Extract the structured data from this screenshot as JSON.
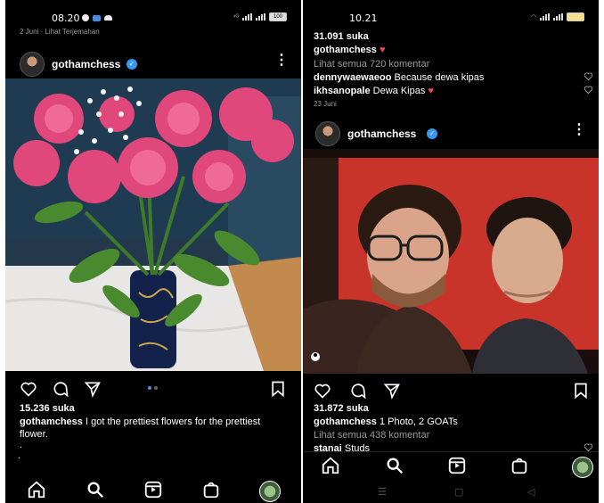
{
  "left": {
    "status": {
      "time": "08.20",
      "battery": "100"
    },
    "subline": "2 Juni · Lihat Terjemahan",
    "post": {
      "username": "gothamchess",
      "likes": "15.236 suka",
      "caption_user": "gothamchess",
      "caption_text": "I got the prettiest flowers for the prettiest flower.",
      "caption_extra": [
        ".",
        " ."
      ]
    },
    "nav": [
      "home-icon",
      "search-icon",
      "reels-icon",
      "shop-icon",
      "profile-avatar"
    ]
  },
  "right": {
    "status": {
      "time": "10.21"
    },
    "prev_post": {
      "likes": "31.091 suka",
      "caption_user": "gothamchess",
      "view_comments": "Lihat semua 720 komentar",
      "comments": [
        {
          "user": "dennywaewaeoo",
          "text": "Because dewa kipas"
        },
        {
          "user": "ikhsanopale",
          "text": "Dewa Kipas"
        }
      ],
      "date": "23 Juni"
    },
    "post": {
      "username": "gothamchess",
      "likes": "31.872 suka",
      "caption_user": "gothamchess",
      "caption_text": "1 Photo, 2 GOATs",
      "view_comments": "Lihat semua 438 komentar",
      "comment_user": "stanai",
      "comment_text": "Studs"
    },
    "nav": [
      "home-icon",
      "search-icon",
      "reels-icon",
      "shop-icon",
      "profile-avatar"
    ]
  },
  "colors": {
    "bg": "#000000",
    "verified": "#3897f0",
    "heart": "#ed4956",
    "muted": "#9a9a9a"
  }
}
